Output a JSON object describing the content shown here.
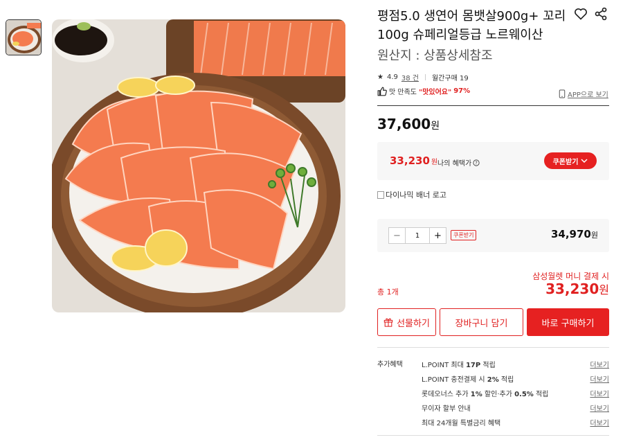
{
  "product": {
    "title": "평점5.0 생연어 몸뱃살900g+ 꼬리 100g 슈페리얼등급 노르웨이산",
    "origin": "원산지 : 상품상세참조"
  },
  "rating": {
    "star": "★",
    "score": "4.9",
    "reviews": "38 건",
    "monthly": "월간구매 19"
  },
  "satisfaction": {
    "label": "맛 만족도",
    "quote": "\"맛있어요\"",
    "percent": "97%"
  },
  "app_link": "APP으로 보기",
  "price": {
    "amount": "37,600",
    "unit": "원"
  },
  "benefit": {
    "amount": "33,230",
    "unit": "원",
    "label": "나의 혜택가",
    "coupon_button": "쿠폰받기"
  },
  "banner_alt": "다이나믹 배너 로고",
  "quantity": {
    "value": "1",
    "coupon_tag": "쿠폰받기",
    "line_amount": "34,970",
    "unit": "원"
  },
  "payment_note": "삼성월렛 머니 결제 시",
  "total": {
    "label": "총 1개",
    "amount": "33,230",
    "unit": "원"
  },
  "buttons": {
    "gift": "선물하기",
    "cart": "장바구니 담기",
    "buy": "바로 구매하기"
  },
  "extra_benefits": {
    "title": "추가혜택",
    "more_label": "더보기",
    "items": [
      {
        "pre": "L.POINT 최대 ",
        "bold": "17P",
        "post": " 적립"
      },
      {
        "pre": "L.POINT 충전결제 시 ",
        "bold": "2%",
        "post": " 적립"
      },
      {
        "pre": "롯데오너스 추가 ",
        "bold": "1%",
        "post": " 할인·추가 ",
        "bold2": "0.5%",
        "post2": " 적립"
      },
      {
        "pre": "무이자 할부 안내",
        "bold": "",
        "post": ""
      },
      {
        "pre": "최대 24개월 특별금리 혜택",
        "bold": "",
        "post": ""
      }
    ]
  },
  "colors": {
    "accent": "#e62121",
    "salmon": "#f47b4f",
    "wood": "#8a5a35"
  }
}
